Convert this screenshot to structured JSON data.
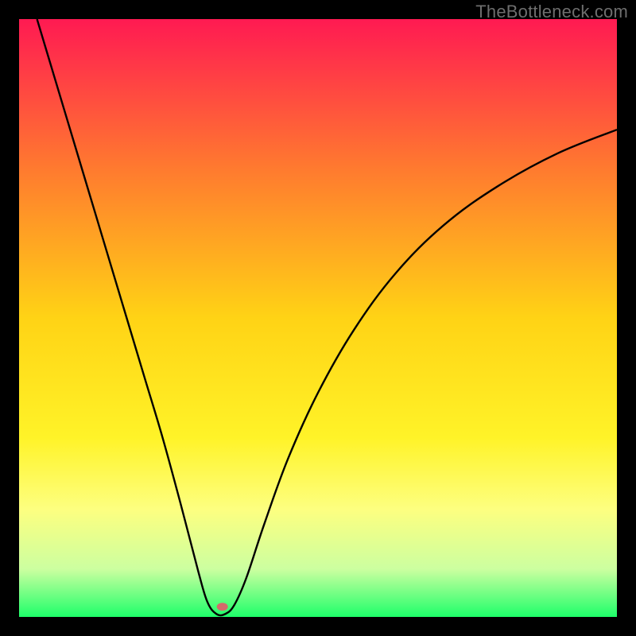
{
  "watermark": "TheBottleneck.com",
  "chart_data": {
    "type": "line",
    "title": "",
    "xlabel": "",
    "ylabel": "",
    "xlim": [
      0,
      100
    ],
    "ylim": [
      0,
      100
    ],
    "grid": false,
    "legend": false,
    "background_gradient": [
      {
        "pos": 0.0,
        "color": "#ff1a52"
      },
      {
        "pos": 0.25,
        "color": "#ff7a2f"
      },
      {
        "pos": 0.5,
        "color": "#ffd315"
      },
      {
        "pos": 0.7,
        "color": "#fff328"
      },
      {
        "pos": 0.82,
        "color": "#fdff80"
      },
      {
        "pos": 0.92,
        "color": "#ccffa0"
      },
      {
        "pos": 1.0,
        "color": "#1eff6a"
      }
    ],
    "curve_note": "V-shaped bottleneck curve; percent-style values (0=best, 100=worst). Minimum near x≈33 at y≈0.",
    "series": [
      {
        "name": "bottleneck-curve",
        "color": "#000000",
        "points": [
          {
            "x": 3.0,
            "y": 100.0
          },
          {
            "x": 6.0,
            "y": 90.0
          },
          {
            "x": 9.0,
            "y": 80.0
          },
          {
            "x": 12.0,
            "y": 70.0
          },
          {
            "x": 15.0,
            "y": 60.0
          },
          {
            "x": 18.0,
            "y": 50.0
          },
          {
            "x": 21.0,
            "y": 40.0
          },
          {
            "x": 24.0,
            "y": 30.0
          },
          {
            "x": 27.0,
            "y": 19.0
          },
          {
            "x": 30.0,
            "y": 7.5
          },
          {
            "x": 31.5,
            "y": 2.5
          },
          {
            "x": 33.0,
            "y": 0.5
          },
          {
            "x": 34.5,
            "y": 0.5
          },
          {
            "x": 36.0,
            "y": 2.0
          },
          {
            "x": 38.0,
            "y": 6.5
          },
          {
            "x": 41.0,
            "y": 15.5
          },
          {
            "x": 45.0,
            "y": 26.5
          },
          {
            "x": 50.0,
            "y": 37.5
          },
          {
            "x": 56.0,
            "y": 48.0
          },
          {
            "x": 63.0,
            "y": 57.5
          },
          {
            "x": 71.0,
            "y": 65.5
          },
          {
            "x": 80.0,
            "y": 72.0
          },
          {
            "x": 90.0,
            "y": 77.5
          },
          {
            "x": 100.0,
            "y": 81.5
          }
        ]
      }
    ],
    "marker": {
      "x": 34.0,
      "y": 1.7,
      "color": "#d46a6a"
    }
  }
}
